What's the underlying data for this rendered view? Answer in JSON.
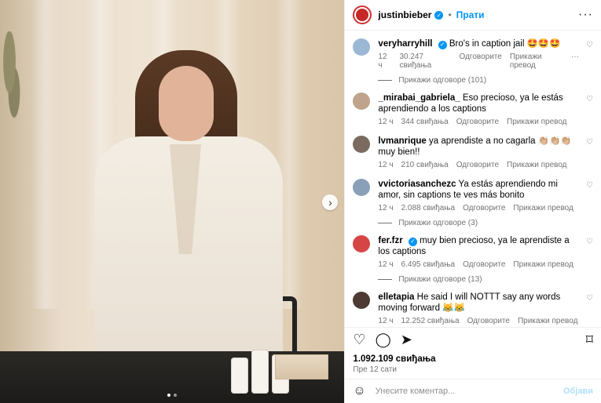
{
  "post": {
    "header": {
      "username": "justinbieber",
      "separator": "•",
      "follow_label": "Прати",
      "more_label": "···"
    },
    "comments": [
      {
        "username": "veryharryhill",
        "verified": true,
        "text": "Bro's in caption jail 🤩🤩🤩",
        "time": "12 ч",
        "likes": "30.247 свиђања",
        "reply": "Одговорите",
        "translate": "Прикажи превод",
        "more": "···",
        "view_replies": "Прикажи одговоре (101)"
      },
      {
        "username": "_mirabai_gabriela_",
        "verified": false,
        "text": "Eso precioso, ya le estás aprendiendo a los captions",
        "time": "12 ч",
        "likes": "344 свиђања",
        "reply": "Одговорите",
        "translate": "Прикажи превод",
        "view_replies": ""
      },
      {
        "username": "lvmanrique",
        "verified": false,
        "text": "ya aprendiste a no cagarla 👏🏼👏🏼👏🏼 muy bien!!",
        "time": "12 ч",
        "likes": "210 свиђања",
        "reply": "Одговорите",
        "translate": "Прикажи превод",
        "view_replies": ""
      },
      {
        "username": "vvictoriasanchezc",
        "verified": false,
        "text": "Ya estás aprendiendo mi amor, sin captions te ves más bonito",
        "time": "12 ч",
        "likes": "2.088 свиђања",
        "reply": "Одговорите",
        "translate": "Прикажи превод",
        "view_replies": "Прикажи одговоре (3)"
      },
      {
        "username": "fer.fzr",
        "verified": true,
        "text": "muy bien precioso, ya le aprendiste a los captions",
        "time": "12 ч",
        "likes": "6.495 свиђања",
        "reply": "Одговорите",
        "translate": "Прикажи превод",
        "view_replies": "Прикажи одговоре (13)"
      },
      {
        "username": "elletapia",
        "verified": false,
        "text": "He said I will NOTTT say any words moving forward 😹😹",
        "time": "12 ч",
        "likes": "12.252 свиђања",
        "reply": "Одговорите",
        "translate": "Прикажи превод",
        "view_replies": ""
      }
    ],
    "likes_count": "1.092.109 свиђања",
    "posted_time": "Пре 12 сати",
    "comment_input": {
      "placeholder": "Унесите коментар...",
      "post_label": "Објави"
    }
  },
  "icons": {
    "heart": "heart-icon",
    "comment": "comment-icon",
    "share": "share-icon",
    "save": "bookmark-icon",
    "emoji": "emoji-icon",
    "arrow": "chevron-right-icon"
  },
  "colors": {
    "link_blue": "#0095f6",
    "meta_gray": "#737373",
    "verified_blue": "#0095f6",
    "post_disabled": "#b2dffc"
  }
}
